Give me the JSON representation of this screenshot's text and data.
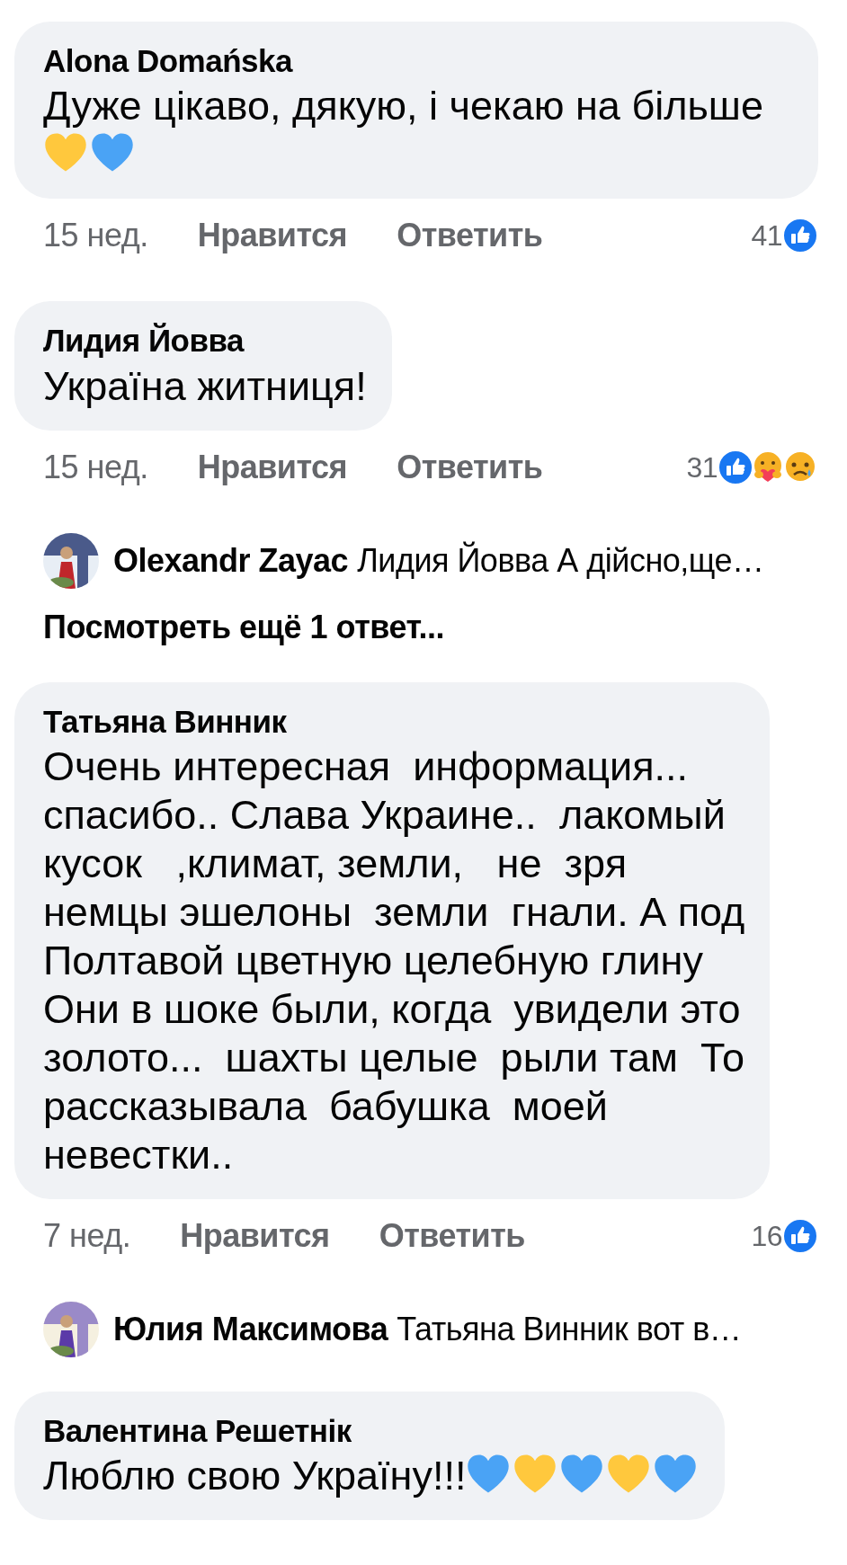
{
  "thread": [
    {
      "kind": "comment",
      "author": "Alona Domańska",
      "text": "Дуже цікаво, дякую, і чекаю на більше",
      "hearts": [
        {
          "color": "#ffc83d"
        },
        {
          "color": "#4aa3f5"
        }
      ],
      "time": "15 нед.",
      "like": "Нравится",
      "reply": "Ответить",
      "count": "41",
      "reactions": [
        {
          "kind": "like"
        }
      ]
    },
    {
      "kind": "comment",
      "author": "Лидия Йовва",
      "text": "Україна житниця!",
      "time": "15 нед.",
      "like": "Нравится",
      "reply": "Ответить",
      "count": "31",
      "reactions": [
        {
          "kind": "like"
        },
        {
          "kind": "care"
        },
        {
          "kind": "sad"
        }
      ]
    },
    {
      "kind": "reply",
      "author": "Olexandr Zayac",
      "text": "Лидия Йовва А дійсно,ще…"
    },
    {
      "kind": "more",
      "text": "Посмотреть ещё 1 ответ..."
    },
    {
      "kind": "comment",
      "author": "Татьяна Винник",
      "text": "Очень интересная  информация...\nспасибо.. Слава Украине..  лакомый\nкусок   ,климат, земли,   не  зря\nнемцы эшелоны  земли  гнали. А под\nПолтавой цветную целебную глину\nОни в шоке были, когда  увидели это\nзолото...  шахты целые  рыли там  То\nрассказывала  бабушка  моей\nневестки..",
      "time": "7 нед.",
      "like": "Нравится",
      "reply": "Ответить",
      "count": "16",
      "reactions": [
        {
          "kind": "like"
        }
      ]
    },
    {
      "kind": "reply",
      "author": "Юлия Максимова",
      "text": "Татьяна Винник вот в…"
    },
    {
      "kind": "comment",
      "author": "Валентина Решетнік",
      "text": "Люблю свою Україну!!!",
      "hearts": [
        {
          "color": "#4aa3f5"
        },
        {
          "color": "#ffc83d"
        },
        {
          "color": "#4aa3f5"
        },
        {
          "color": "#ffc83d"
        },
        {
          "color": "#4aa3f5"
        }
      ]
    }
  ]
}
